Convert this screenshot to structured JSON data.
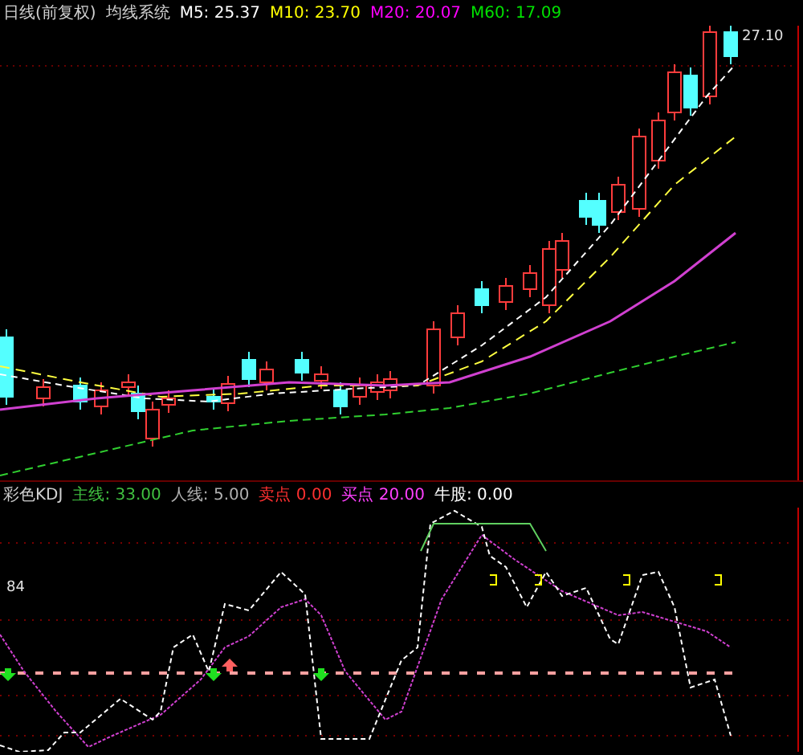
{
  "price_panel": {
    "legend": [
      {
        "text": "日线(前复权)",
        "color": "#d0d0d0"
      },
      {
        "text": "均线系统",
        "color": "#d0d0d0"
      },
      {
        "text": "M5: 25.37",
        "color": "#ffffff"
      },
      {
        "text": "M10: 23.70",
        "color": "#ffff00"
      },
      {
        "text": "M20: 20.07",
        "color": "#ff00ff"
      },
      {
        "text": "M60: 17.09",
        "color": "#00e000"
      }
    ],
    "last_price": "27.10"
  },
  "indicator_panel": {
    "legend": [
      {
        "text": "彩色KDJ",
        "color": "#d0d0d0"
      },
      {
        "text": "主线: 33.00",
        "color": "#40c040"
      },
      {
        "text": "人线: 5.00",
        "color": "#b0b0b0"
      },
      {
        "text": "卖点 0.00",
        "color": "#ff3030"
      },
      {
        "text": "买点 20.00",
        "color": "#ff40ff"
      },
      {
        "text": "牛股: 0.00",
        "color": "#ffffff"
      }
    ],
    "level_label": "84"
  }
}
